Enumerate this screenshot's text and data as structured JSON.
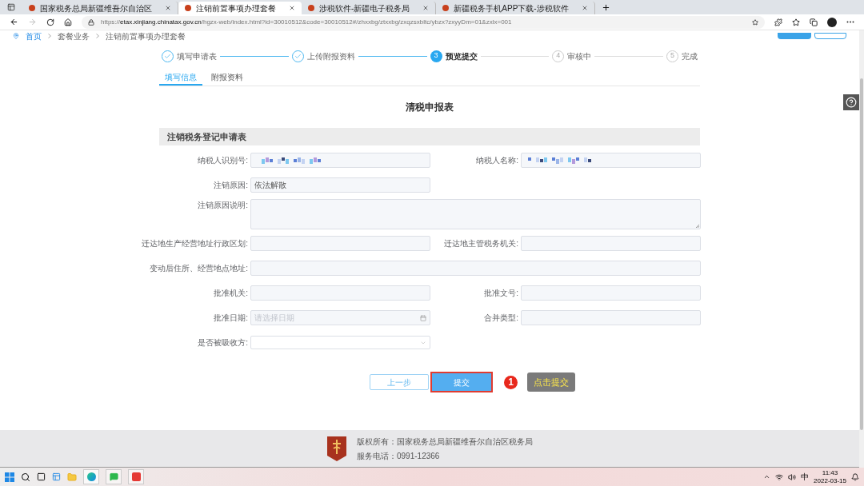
{
  "browser": {
    "tabs": [
      {
        "title": "国家税务总局新疆维吾尔自治区",
        "selected": false
      },
      {
        "title": "注销前置事项办理套餐",
        "selected": true
      },
      {
        "title": "涉税软件-新疆电子税务局",
        "selected": false
      },
      {
        "title": "新疆税务手机APP下载-涉税软件",
        "selected": false
      }
    ],
    "url": {
      "scheme": "https://",
      "host": "etax.xinjiang.chinatax.gov.cn",
      "path": "/hgzx-web/index.html?id=30010512&code=30010512#/zhxxbg/ztxxbg/zxqzsxbltc/ybzx?zxyyDm=01&zxlx=001"
    }
  },
  "breadcrumb": [
    "首页",
    "套餐业务",
    "注销前置事项办理套餐"
  ],
  "steps": [
    {
      "label": "填写申请表",
      "done": true,
      "current": false
    },
    {
      "label": "上传附报资料",
      "done": true,
      "current": false
    },
    {
      "number": "3",
      "label": "预览提交",
      "done": false,
      "current": true
    },
    {
      "number": "4",
      "label": "审核中",
      "done": false,
      "current": false
    },
    {
      "number": "5",
      "label": "完成",
      "done": false,
      "current": false
    }
  ],
  "subtabs": [
    {
      "label": "填写信息",
      "selected": true
    },
    {
      "label": "附报资料",
      "selected": false
    }
  ],
  "form_title": "清税申报表",
  "section_title": "注销税务登记申请表",
  "rows": [
    [
      {
        "label": "纳税人识别号:",
        "kind": "masked"
      },
      {
        "label": "纳税人名称:",
        "kind": "masked"
      }
    ],
    [
      {
        "label": "注销原因:",
        "kind": "text",
        "value": "依法解散"
      }
    ],
    [
      {
        "label": "注销原因说明:",
        "kind": "textarea"
      }
    ],
    [
      {
        "label": "迁达地生产经营地址行政区划:",
        "kind": "text"
      },
      {
        "label": "迁达地主管税务机关:",
        "kind": "text"
      }
    ],
    [
      {
        "label": "变动后住所、经营地点地址:",
        "kind": "wide"
      }
    ],
    [
      {
        "label": "批准机关:",
        "kind": "text"
      },
      {
        "label": "批准文号:",
        "kind": "text"
      }
    ],
    [
      {
        "label": "批准日期:",
        "kind": "date",
        "placeholder": "请选择日期"
      },
      {
        "label": "合并类型:",
        "kind": "text"
      }
    ],
    [
      {
        "label": "是否被吸收方:",
        "kind": "select"
      }
    ]
  ],
  "buttons": {
    "back": "上一步",
    "submit": "提交"
  },
  "annotation": {
    "number": "1",
    "text": "点击提交"
  },
  "footer": {
    "copyright": "版权所有：国家税务总局新疆维吾尔自治区税务局",
    "phone": "服务电话：0991-12366"
  },
  "taskbar": {
    "ime": "中",
    "time": "11:43",
    "date": "2022-03-15"
  }
}
